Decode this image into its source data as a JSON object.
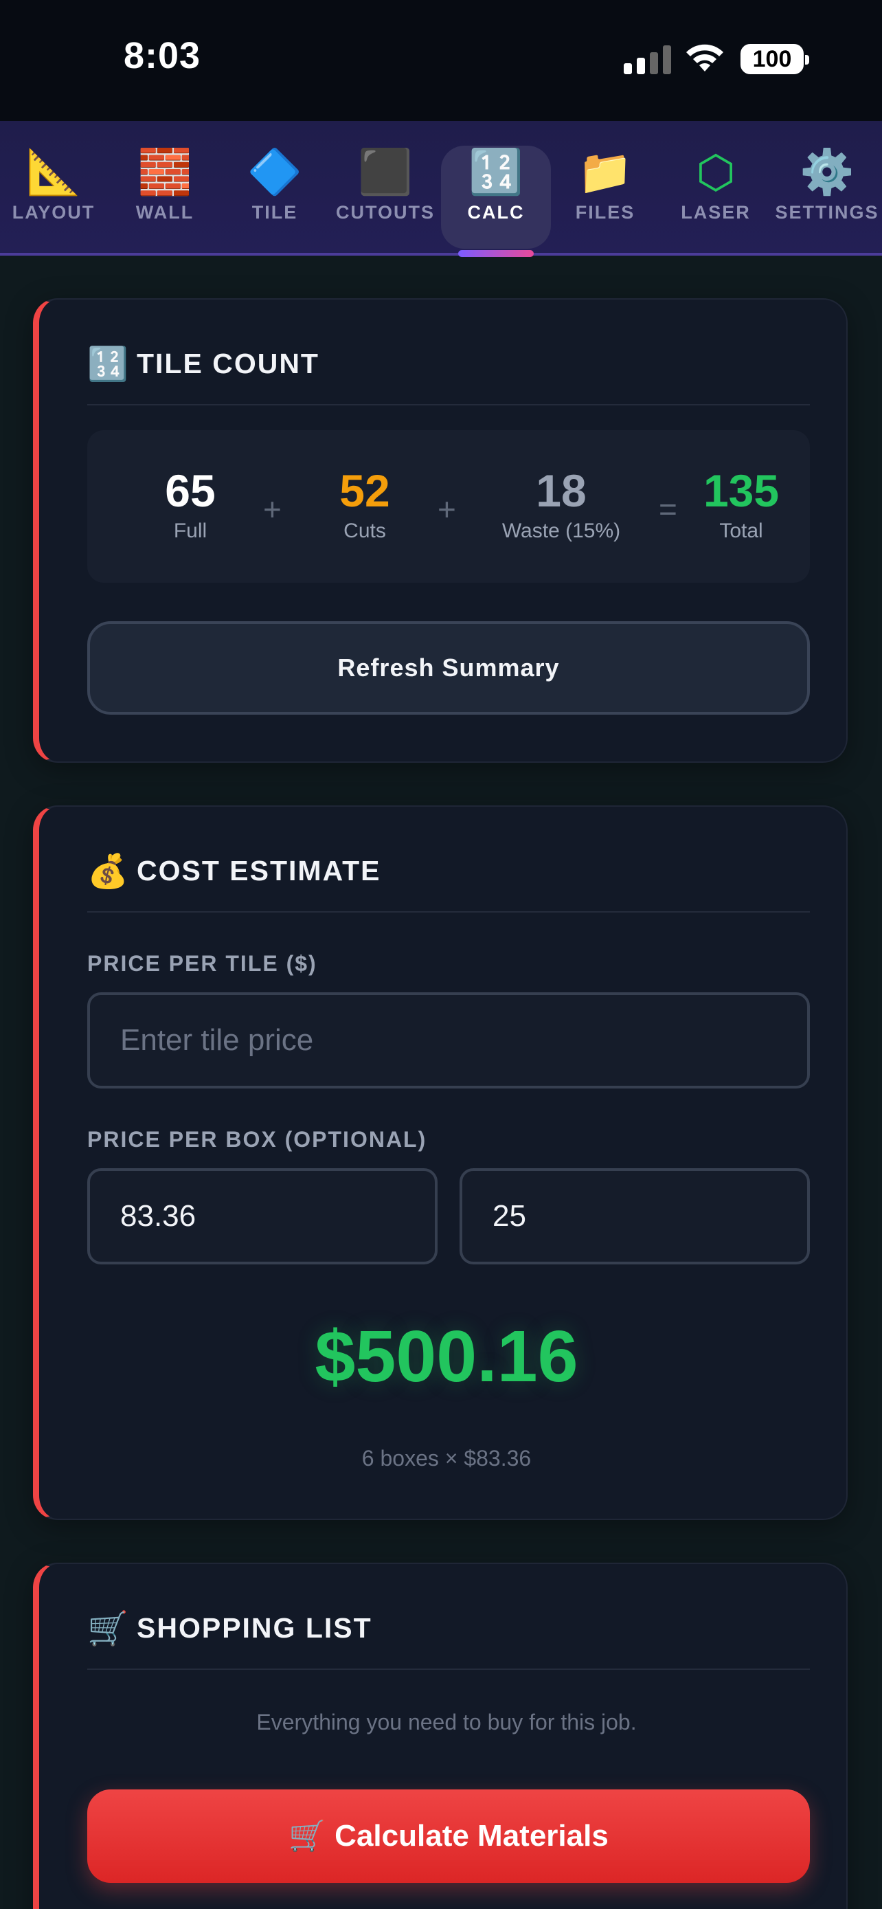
{
  "status_bar": {
    "time": "8:03",
    "battery": "100"
  },
  "tabs": [
    {
      "icon": "📐",
      "label": "LAYOUT"
    },
    {
      "icon": "🧱",
      "label": "WALL"
    },
    {
      "icon": "🔷",
      "label": "TILE"
    },
    {
      "icon": "⬛",
      "label": "CUTOUTS"
    },
    {
      "icon": "🔢",
      "label": "CALC",
      "active": true
    },
    {
      "icon": "📁",
      "label": "FILES"
    },
    {
      "icon": "⬡",
      "label": "LASER"
    },
    {
      "icon": "⚙️",
      "label": "SETTINGS"
    }
  ],
  "tile_count": {
    "icon": "🔢",
    "title": "TILE COUNT",
    "full": {
      "value": "65",
      "label": "Full"
    },
    "cuts": {
      "value": "52",
      "label": "Cuts"
    },
    "waste": {
      "value": "18",
      "label": "Waste (15%)"
    },
    "total": {
      "value": "135",
      "label": "Total"
    },
    "op_plus": "+",
    "op_equals": "=",
    "refresh_label": "Refresh Summary"
  },
  "cost_estimate": {
    "icon": "💰",
    "title": "COST ESTIMATE",
    "price_per_tile_label": "PRICE PER TILE ($)",
    "price_per_tile_placeholder": "Enter tile price",
    "price_per_box_label": "PRICE PER BOX (OPTIONAL)",
    "box_price_value": "83.36",
    "box_qty_value": "25",
    "total": "$500.16",
    "note": "6 boxes × $83.36"
  },
  "shopping_list": {
    "icon": "🛒",
    "title": "SHOPPING LIST",
    "description": "Everything you need to buy for this job.",
    "button_label": "🛒 Calculate Materials"
  },
  "colors": {
    "accent_red": "#ef4444",
    "green": "#22c55e",
    "orange": "#f59e0b",
    "gray": "#9aa3b4"
  }
}
